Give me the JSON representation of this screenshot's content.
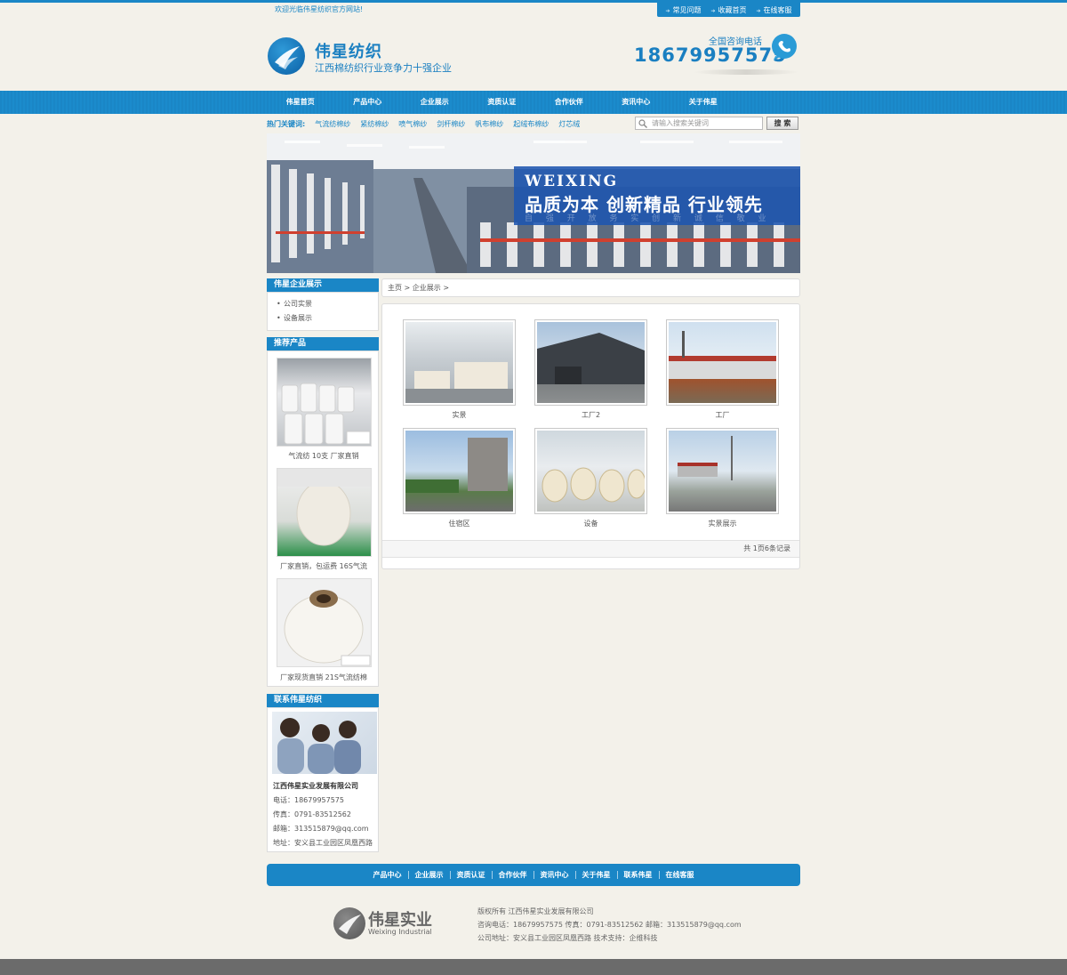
{
  "topbar": {
    "welcome": "欢迎光临伟星纺织官方网站!",
    "links": [
      "常见问题",
      "收藏首页",
      "在线客服"
    ]
  },
  "header": {
    "brand": "伟星纺织",
    "slogan": "江西棉纺织行业竞争力十强企业",
    "hotline_label": "全国咨询电话",
    "phone": "18679957575"
  },
  "nav": [
    "伟星首页",
    "产品中心",
    "企业展示",
    "资质认证",
    "合作伙伴",
    "资讯中心",
    "关于伟星"
  ],
  "hot": {
    "label": "热门关键词:",
    "keywords": [
      "气流纺棉纱",
      "紧纺棉纱",
      "喷气棉纱",
      "剑杆棉纱",
      "帆布棉纱",
      "起绒布棉纱",
      "灯芯绒"
    ]
  },
  "search": {
    "placeholder": "请输入搜索关键词",
    "button": "搜 索"
  },
  "banner": {
    "en": "WEIXING",
    "cn": "品质为本  创新精品  行业领先",
    "sub": "自 强 开 放  务 实 创 新  诚 信 敬 业"
  },
  "sidebar": {
    "showcase_title": "伟星企业展示",
    "showcase_links": [
      "公司实景",
      "设备展示"
    ],
    "products_title": "推荐产品",
    "products": [
      "气流纺 10支 厂家直销",
      "厂家直销，包运费 16S气流",
      "厂家现货直销 21S气流纺棉"
    ],
    "contact_title": "联系伟星纺织",
    "contact": {
      "company": "江西伟星实业发展有限公司",
      "tel": "电话：18679957575",
      "fax": "传真：0791-83512562",
      "email": "邮箱：313515879@qq.com",
      "address": "地址：安义县工业园区凤凰西路"
    }
  },
  "main": {
    "breadcrumb": "主页 > 企业展示 >",
    "items": [
      "实景",
      "工厂2",
      "工厂",
      "住宿区",
      "设备",
      "实景展示"
    ],
    "pager": "共 1页6条记录"
  },
  "footer": {
    "nav": [
      "产品中心",
      "企业展示",
      "资质认证",
      "合作伙伴",
      "资讯中心",
      "关于伟星",
      "联系伟星",
      "在线客服"
    ],
    "brand": "伟星实业",
    "brand_en": "Weixing Industrial",
    "copyright": "版权所有 江西伟星实业发展有限公司",
    "contacts": "咨询电话：18679957575   传真：0791-83512562   邮箱：313515879@qq.com",
    "address": "公司地址：安义县工业园区凤凰西路   技术支持：企维科技"
  },
  "colors": {
    "accent": "#1a86c6",
    "background": "#f3f1ea"
  }
}
